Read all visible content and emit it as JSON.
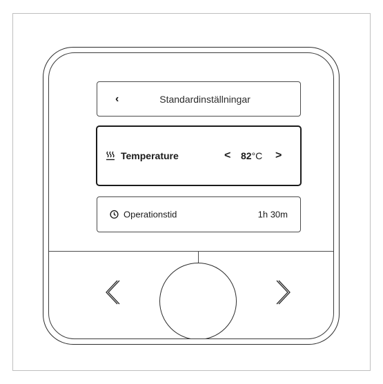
{
  "header": {
    "back_icon": "chevron-left-icon",
    "title": "Standardinställningar"
  },
  "temperature": {
    "icon": "heating-icon",
    "label": "Temperature",
    "decrease_symbol": "<",
    "increase_symbol": ">",
    "value": "82",
    "unit": "°C"
  },
  "operation_time": {
    "icon": "clock-icon",
    "label": "Operationstid",
    "value": "1h 30m"
  },
  "controls": {
    "left_button_icon": "arrow-left-icon",
    "right_button_icon": "arrow-right-icon",
    "knob": "rotary-knob"
  }
}
